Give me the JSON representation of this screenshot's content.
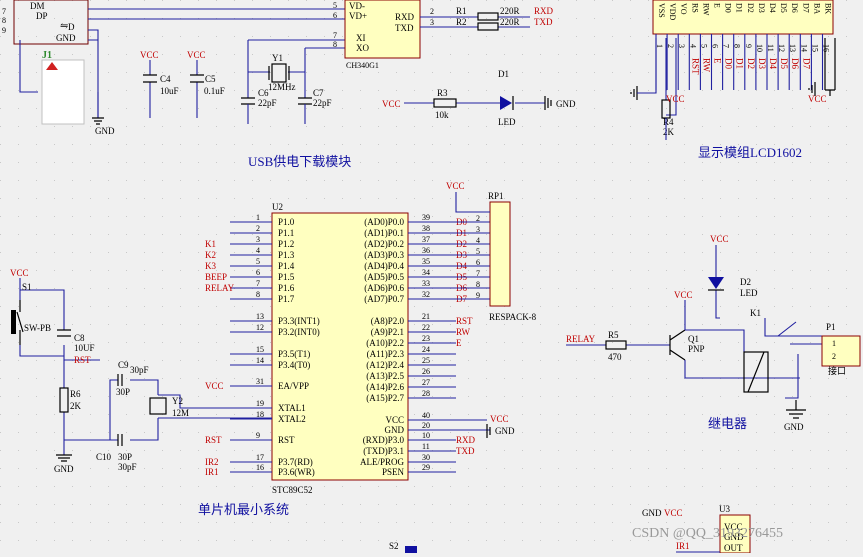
{
  "colors": {
    "wire": "#2020a0",
    "chip_fill": "#ffffc0",
    "label_red": "#c00000",
    "title": "#1010a0",
    "background": "#f0f0f0"
  },
  "usb": {
    "title": "USB供电下载模块",
    "j1": {
      "ref": "J1",
      "pins": [
        "DM",
        "DP",
        "D",
        "GND"
      ],
      "nums": [
        "7",
        "8",
        "",
        "9"
      ]
    },
    "ch340": {
      "ref": "CH340G1",
      "left_pins": [
        "VD-",
        "VD+",
        "XI",
        "XO"
      ],
      "left_nums": [
        "5",
        "6",
        "7",
        "8"
      ],
      "right_pins": [
        "RXD",
        "TXD"
      ],
      "right_nums": [
        "2",
        "3"
      ]
    },
    "r1": {
      "ref": "R1",
      "value": "220R"
    },
    "r2": {
      "ref": "R2",
      "value": "220R"
    },
    "net_rxd": "RXD",
    "net_txd": "TXD",
    "c4": {
      "ref": "C4",
      "value": "10uF"
    },
    "c5": {
      "ref": "C5",
      "value": "0.1uF"
    },
    "c6": {
      "ref": "C6",
      "value": "22pF"
    },
    "c7": {
      "ref": "C7",
      "value": "22pF"
    },
    "y1": {
      "ref": "Y1",
      "value": "12MHz"
    },
    "r3": {
      "ref": "R3",
      "value": "10k"
    },
    "d1": {
      "ref": "D1",
      "value": "LED"
    },
    "vcc": "VCC",
    "gnd": "GND"
  },
  "lcd": {
    "title": "显示模组LCD1602",
    "pins": [
      "VSS",
      "VDD",
      "VO",
      "RS",
      "RW",
      "E",
      "D0",
      "D1",
      "D2",
      "D3",
      "D4",
      "D5",
      "D6",
      "D7",
      "BA",
      "BK"
    ],
    "nums": [
      "1",
      "2",
      "3",
      "4",
      "5",
      "6",
      "7",
      "8",
      "9",
      "10",
      "11",
      "12",
      "13",
      "14",
      "15",
      "16"
    ],
    "nets": [
      "RST",
      "RW",
      "E",
      "D0",
      "D1",
      "D2",
      "D3",
      "D4",
      "D5",
      "D6",
      "D7"
    ],
    "r4": {
      "ref": "R4",
      "value": "2K"
    }
  },
  "mcu": {
    "title": "单片机最小系统",
    "ref": "U2",
    "part": "STC89C52",
    "left_pins": [
      "P1.0",
      "P1.1",
      "P1.2",
      "P1.3",
      "P1.4",
      "P1.5",
      "P1.6",
      "P1.7",
      "P3.3(INT1)",
      "P3.2(INT0)",
      "P3.5(T1)",
      "P3.4(T0)",
      "EA/VPP",
      "XTAL1",
      "XTAL2",
      "RST",
      "P3.7(RD)",
      "P3.6(WR)"
    ],
    "left_nums": [
      "1",
      "2",
      "3",
      "4",
      "5",
      "6",
      "7",
      "8",
      "13",
      "12",
      "15",
      "14",
      "31",
      "19",
      "18",
      "9",
      "17",
      "16"
    ],
    "left_nets": [
      "",
      "",
      "K1",
      "K2",
      "K3",
      "BEEP",
      "RELAY",
      "",
      "",
      "",
      "",
      "",
      "VCC",
      "",
      "",
      "RST",
      "IR2",
      "IR1"
    ],
    "right_pins": [
      "(AD0)P0.0",
      "(AD1)P0.1",
      "(AD2)P0.2",
      "(AD3)P0.3",
      "(AD4)P0.4",
      "(AD5)P0.5",
      "(AD6)P0.6",
      "(AD7)P0.7",
      "(A8)P2.0",
      "(A9)P2.1",
      "(A10)P2.2",
      "(A11)P2.3",
      "(A12)P2.4",
      "(A13)P2.5",
      "(A14)P2.6",
      "(A15)P2.7",
      "VCC",
      "GND",
      "(RXD)P3.0",
      "(TXD)P3.1",
      "ALE/PROG",
      "PSEN"
    ],
    "right_nums": [
      "39",
      "38",
      "37",
      "36",
      "35",
      "34",
      "33",
      "32",
      "21",
      "22",
      "23",
      "24",
      "25",
      "26",
      "27",
      "28",
      "40",
      "20",
      "10",
      "11",
      "30",
      "29"
    ],
    "right_nets": [
      "D0",
      "D1",
      "D2",
      "D3",
      "D4",
      "D5",
      "D6",
      "D7",
      "RST",
      "RW",
      "E",
      "",
      "",
      "",
      "",
      "",
      "",
      "",
      "RXD",
      "TXD",
      "",
      ""
    ],
    "rp1": {
      "ref": "RP1",
      "part": "RESPACK-8",
      "nums": [
        "2",
        "3",
        "4",
        "5",
        "6",
        "7",
        "8",
        "9"
      ]
    },
    "s1": {
      "ref": "S1",
      "part": "SW-PB"
    },
    "c8": {
      "ref": "C8",
      "value": "10UF"
    },
    "r6": {
      "ref": "R6",
      "value": "2K"
    },
    "c9": {
      "ref": "C9",
      "value": "30pF",
      "alt": "30P"
    },
    "c10": {
      "ref": "C10",
      "value": "30pF",
      "alt": "30P"
    },
    "y2": {
      "ref": "Y2",
      "value": "12M"
    },
    "net_rst": "RST"
  },
  "relay": {
    "title": "继电器",
    "net": "RELAY",
    "r5": {
      "ref": "R5",
      "value": "470"
    },
    "q1": {
      "ref": "Q1",
      "type": "PNP"
    },
    "d2": {
      "ref": "D2",
      "value": "LED"
    },
    "k1": {
      "ref": "K1"
    },
    "p1": {
      "ref": "P1",
      "label": "接口",
      "nums": [
        "1",
        "2"
      ]
    }
  },
  "u3": {
    "ref": "U3",
    "pins": [
      "VCC",
      "GND",
      "OUT"
    ],
    "net": "IR1"
  },
  "s2": {
    "ref": "S2"
  },
  "watermark": "CSDN @QQ_3193276455"
}
